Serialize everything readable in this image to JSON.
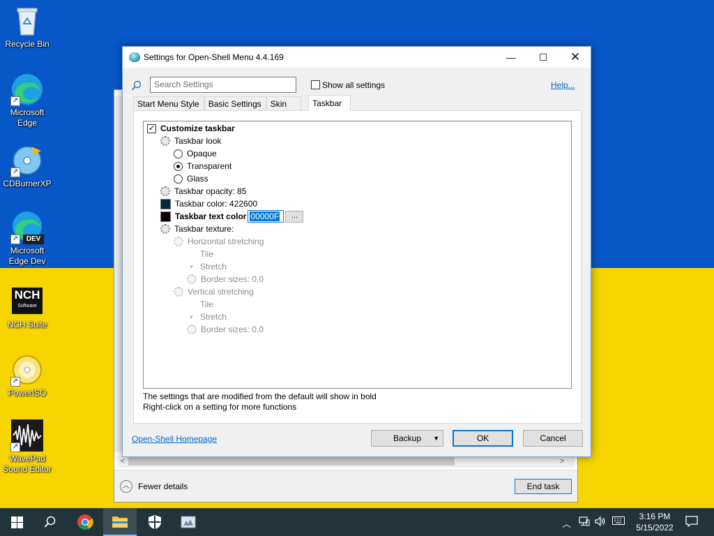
{
  "desktop": {
    "icons": [
      {
        "label": "Recycle Bin",
        "icon": "recycle-bin-icon"
      },
      {
        "label": "Microsoft Edge",
        "icon": "edge-icon"
      },
      {
        "label": "CDBurnerXP",
        "icon": "cdburnerxp-icon"
      },
      {
        "label": "Microsoft Edge Dev",
        "icon": "edge-dev-icon",
        "badge": "DEV"
      },
      {
        "label": "NCH Suite",
        "icon": "nch-icon",
        "logo_text": "NCH",
        "logo_sub": "Software"
      },
      {
        "label": "PowerISO",
        "icon": "poweriso-icon"
      },
      {
        "label": "WavePad Sound Editor",
        "icon": "wavepad-icon"
      }
    ],
    "colors": {
      "top": "#0757c9",
      "bottom": "#f6d500"
    }
  },
  "task_manager": {
    "fewer_details": "Fewer details",
    "end_task": "End task"
  },
  "dialog": {
    "title": "Settings for Open-Shell Menu 4.4.169",
    "search_placeholder": "Search Settings",
    "show_all": "Show all settings",
    "help": "Help...",
    "tabs": [
      "Start Menu Style",
      "Basic Settings",
      "Skin",
      "Taskbar"
    ],
    "active_tab": "Taskbar",
    "tree": {
      "customize": "Customize taskbar",
      "look": "Taskbar look",
      "opaque": "Opaque",
      "transparent": "Transparent",
      "glass": "Glass",
      "opacity": "Taskbar opacity: 85",
      "color": "Taskbar color: 422600",
      "text_color": "Taskbar text color",
      "text_color_value": "00000F",
      "browse": "...",
      "texture": "Taskbar texture:",
      "h_stretch": "Horizontal stretching",
      "h_tile": "Tile",
      "h_stretch_opt": "Stretch",
      "h_border": "Border sizes: 0,0",
      "v_stretch": "Vertical stretching",
      "v_tile": "Tile",
      "v_stretch_opt": "Stretch",
      "v_border": "Border sizes: 0,0"
    },
    "swatch_colors": {
      "taskbar_color": "#002642",
      "text_color": "#0f0000"
    },
    "hint1": "The settings that are modified from the default will show in bold",
    "hint2": "Right-click on a setting for more functions",
    "homepage": "Open-Shell Homepage",
    "backup": "Backup",
    "ok": "OK",
    "cancel": "Cancel"
  },
  "taskbar": {
    "time": "3:16 PM",
    "date": "5/15/2022"
  }
}
